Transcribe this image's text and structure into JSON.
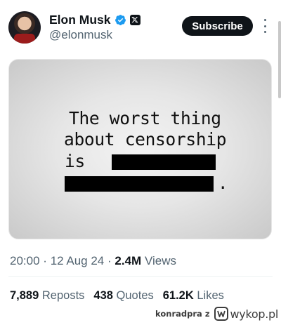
{
  "author": {
    "name": "Elon Musk",
    "handle": "@elonmusk",
    "verified_icon": "verified-badge-icon",
    "affiliate_icon": "x-logo-icon"
  },
  "actions": {
    "subscribe_label": "Subscribe",
    "more_icon": "more-vertical-icon"
  },
  "media": {
    "line1": "The worst thing",
    "line2": "about censorship",
    "line3": "is",
    "period": "."
  },
  "meta": {
    "time": "20:00",
    "separator": "·",
    "date": "12 Aug 24",
    "views_count": "2.4M",
    "views_label": "Views"
  },
  "stats": {
    "reposts_count": "7,889",
    "reposts_label": "Reposts",
    "quotes_count": "438",
    "quotes_label": "Quotes",
    "likes_count": "61.2K",
    "likes_label": "Likes"
  },
  "watermark": {
    "user": "konradpra",
    "z": "z",
    "brand": "wykop.pl"
  },
  "colors": {
    "text_primary": "#0f1419",
    "text_secondary": "#536471",
    "verified_blue": "#1d9bf0",
    "button_bg": "#0f1419"
  }
}
